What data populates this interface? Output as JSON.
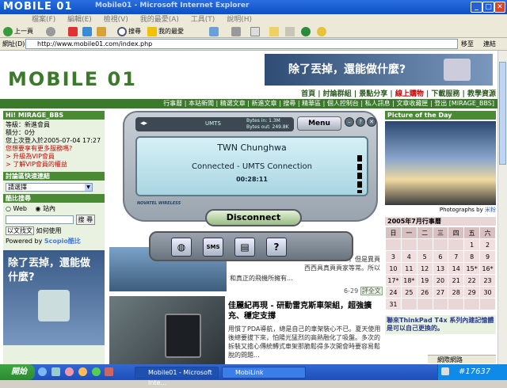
{
  "window": {
    "title": "Mobile01 - Microsoft Internet Explorer",
    "logo_overlay": "MOBILE 01"
  },
  "menu": [
    "檔案(F)",
    "編輯(E)",
    "檢視(V)",
    "我的最愛(A)",
    "工具(T)",
    "說明(H)"
  ],
  "toolbar": {
    "back": "上一頁",
    "search": "搜尋",
    "favorites": "我的最愛"
  },
  "address": {
    "label": "網址(D)",
    "url": "http://www.mobile01.com/index.php",
    "go": "移至",
    "links": "連結"
  },
  "site": {
    "logo": "MOBILE 01",
    "banner_ad": "除了丟掉，還能做什麼?",
    "nav1": [
      "首頁",
      "討論群組",
      "景點分享",
      "線上購物",
      "下載服務",
      "教學資源"
    ],
    "nav2": [
      "行事曆",
      "本站新聞",
      "精選文章",
      "新進文章",
      "搜尋",
      "精華區",
      "個人控制台",
      "私人訊息",
      "文章收藏匣",
      "登出 [MIRAGE_BBS]"
    ]
  },
  "sidebar": {
    "greeting": "Hi! MIRAGE_BBS",
    "level": "等級：新進會員",
    "points": "積分：0分",
    "last_login": "您上次登入於2005-07-04 17:27",
    "vip_q": "您想要享有更多服務嗎?",
    "vip_up": "> 升級為VIP會員",
    "vip_info": "> 了解VIP會員的權益",
    "forum_head": "討論區快速連結",
    "forum_select": "請選擇",
    "search_head": "酷比搜尋",
    "radio_web": "Web",
    "radio_site": "站內",
    "search_btn": "搜 尋",
    "search_text_link": "以文找文",
    "how_to": "如何使用",
    "powered": "Powered by",
    "scopio": "Scopio酷比",
    "ad_text": "除了丟掉，還能做什麼?"
  },
  "article": {
    "snippet_right1": "，但是異頁",
    "snippet_right2": "西西具真頁頁家等常。所以",
    "snippet": "和真正的飛機所擁有...",
    "date": "6-29",
    "review": "評全文",
    "headline": "佳麗紀再現 - 研勤雷克斯車架組，超強擴充、穩定支撐",
    "body": "用慣了PDA導航，總是自己的車架裝心不已。夏天使用後總要拔下來，怕陽光猛烈的高熱融化了吸盤。多次的拆裝又擔心傳統轉式車架那脆鬆得多次開會時要容易鬆脫的問題..."
  },
  "right": {
    "pic_head": "Picture of the Day",
    "photo_credit": "Photographs by",
    "photographer": "米粉",
    "cal_head": "2005年7月行事曆",
    "cal_days": [
      "日",
      "一",
      "二",
      "三",
      "四",
      "五",
      "六"
    ],
    "cal_weeks": [
      [
        "",
        "",
        "",
        "",
        "",
        "1",
        "2"
      ],
      [
        "3",
        "4",
        "5",
        "6",
        "7",
        "8",
        "9"
      ],
      [
        "10",
        "11",
        "12",
        "13",
        "14",
        "15*",
        "16*"
      ],
      [
        "17*",
        "18*",
        "19",
        "20",
        "21",
        "22",
        "23"
      ],
      [
        "24",
        "25",
        "26",
        "27",
        "28",
        "29",
        "30"
      ],
      [
        "31",
        "",
        "",
        "",
        "",
        "",
        ""
      ]
    ],
    "thinkpad": "聯來ThinkPad T4x 系列內建記憶體是可以自己更換的。"
  },
  "mobilink": {
    "network_type": "UMTS",
    "bytes_in": "Bytes in: 1.3M",
    "bytes_out": "Bytes out: 249.8K",
    "menu": "Menu",
    "operator": "TWN Chunghwa",
    "status": "Connected - UMTS Connection",
    "timer": "00:28:11",
    "brand": "NOVATEL WIRELESS",
    "disconnect": "Disconnect",
    "btn_sms": "SMS"
  },
  "statusbar": {
    "zone": "網際網路"
  },
  "taskbar": {
    "start": "開始",
    "task1": "Mobile01 - Microsoft Inte...",
    "task2": "MobiLink",
    "watermark": "#17637"
  },
  "colors": {
    "brand_green": "#3b7a2a",
    "xp_blue": "#1f4fb8"
  }
}
